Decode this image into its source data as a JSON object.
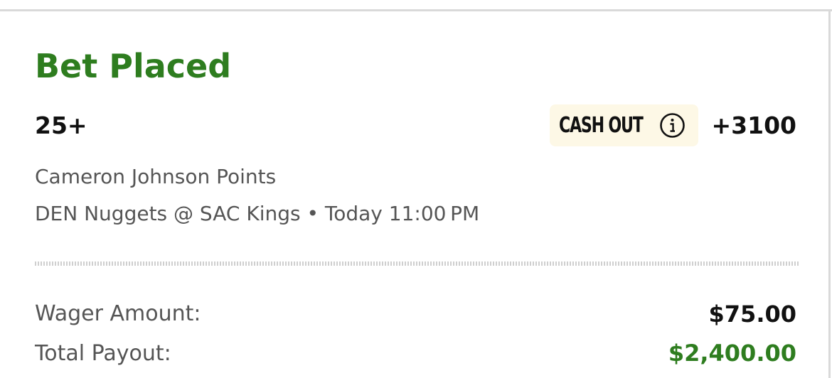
{
  "bet": {
    "status_title": "Bet Placed",
    "selection": "25+",
    "cash_out_label": "CASH OUT",
    "odds": "+3100",
    "market": "Cameron Johnson Points",
    "event": "DEN Nuggets @ SAC Kings • Today 11:00 PM"
  },
  "summary": {
    "wager_label": "Wager Amount:",
    "wager_value": "$75.00",
    "payout_label": "Total Payout:",
    "payout_value": "$2,400.00"
  },
  "icons": {
    "cash_out_info": "info-circle-icon"
  },
  "colors": {
    "accent_green": "#2e7d1f",
    "cash_out_bg": "#fdf8e6",
    "secondary_text": "#555555"
  }
}
